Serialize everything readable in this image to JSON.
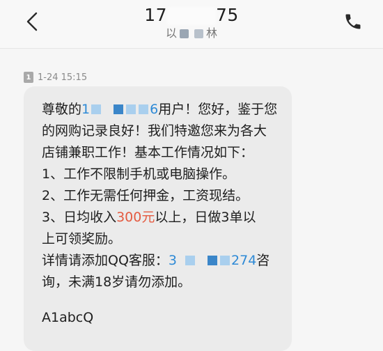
{
  "header": {
    "number_start": "17",
    "number_end": "75",
    "name_start": "以",
    "name_end": "林",
    "back_icon": "chevron-left-icon",
    "call_icon": "phone-icon"
  },
  "message": {
    "sim_slot": "1",
    "timestamp": "1-24 15:15",
    "line1_pre": "尊敬的",
    "line1_link_start": "1",
    "line1_link_end": "6",
    "line1_post": "用户！您好，鉴于您",
    "line2": "的网购记录良好！我们特邀您来为各大",
    "line3": "店铺兼职工作！基本工作情况如下：",
    "line4": "1、工作不限制手机或电脑操作。",
    "line5": "2、工作无需任何押金，工资现结。",
    "line6_pre": "3、日均收入",
    "line6_money": "300元",
    "line6_post": "以上，日做3单以",
    "line7": "上可领奖励。",
    "line8_pre": "详情请添加QQ客服：",
    "line8_link_start": "3",
    "line8_link_end": "274",
    "line8_post": "咨",
    "line9": "询，未满18岁请勿添加。",
    "signature": "A1abcQ"
  },
  "colors": {
    "link": "#2e8ad6",
    "highlight": "#e45a40",
    "bubble": "#ebebeb"
  }
}
